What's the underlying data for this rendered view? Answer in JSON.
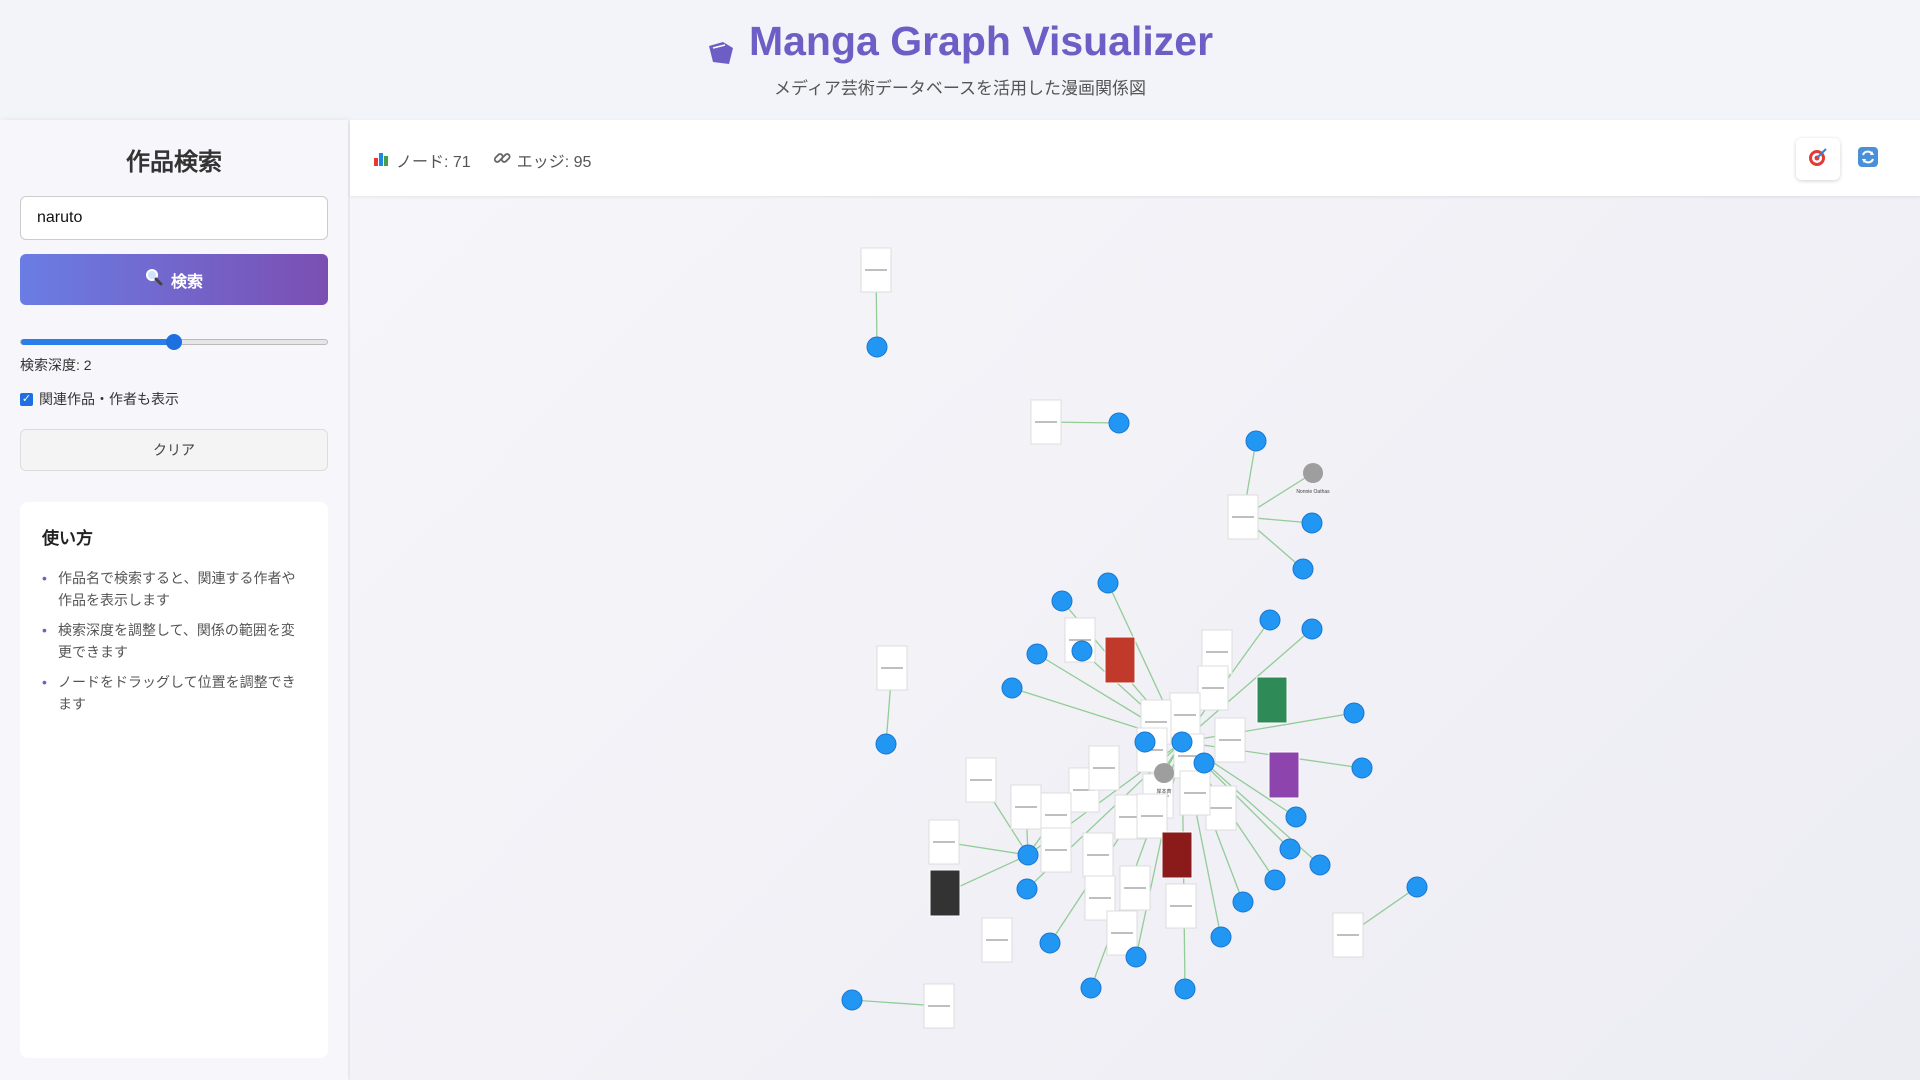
{
  "header": {
    "title": "Manga Graph Visualizer",
    "subtitle": "メディア芸術データベースを活用した漫画関係図",
    "icon": "book-icon",
    "title_color": "#6b5fc6"
  },
  "sidebar": {
    "heading": "作品検索",
    "search_value": "naruto",
    "search_button_label": "検索",
    "depth": {
      "value": 2,
      "min": 1,
      "max": 3
    },
    "depth_label": "検索深度: 2",
    "related_checkbox": {
      "label": "関連作品・作者も表示",
      "checked": true
    },
    "clear_button_label": "クリア",
    "help": {
      "title": "使い方",
      "items": [
        "作品名で検索すると、関連する作者や作品を表示します",
        "検索深度を調整して、関係の範囲を変更できます",
        "ノードをドラッグして位置を調整できます"
      ]
    }
  },
  "toolbar": {
    "nodes_label": "ノード: 71",
    "edges_label": "エッジ: 95",
    "buttons": [
      {
        "icon": "target-icon",
        "active": true
      },
      {
        "icon": "refresh-icon",
        "active": false
      }
    ]
  },
  "graph": {
    "colors": {
      "work": "#2196f3",
      "author": "#9e9e9e",
      "edge": "#7bc47f",
      "card_border": "#dddddd"
    },
    "author_labels": [
      "Nonnie Oathas",
      "岸本斉"
    ]
  }
}
